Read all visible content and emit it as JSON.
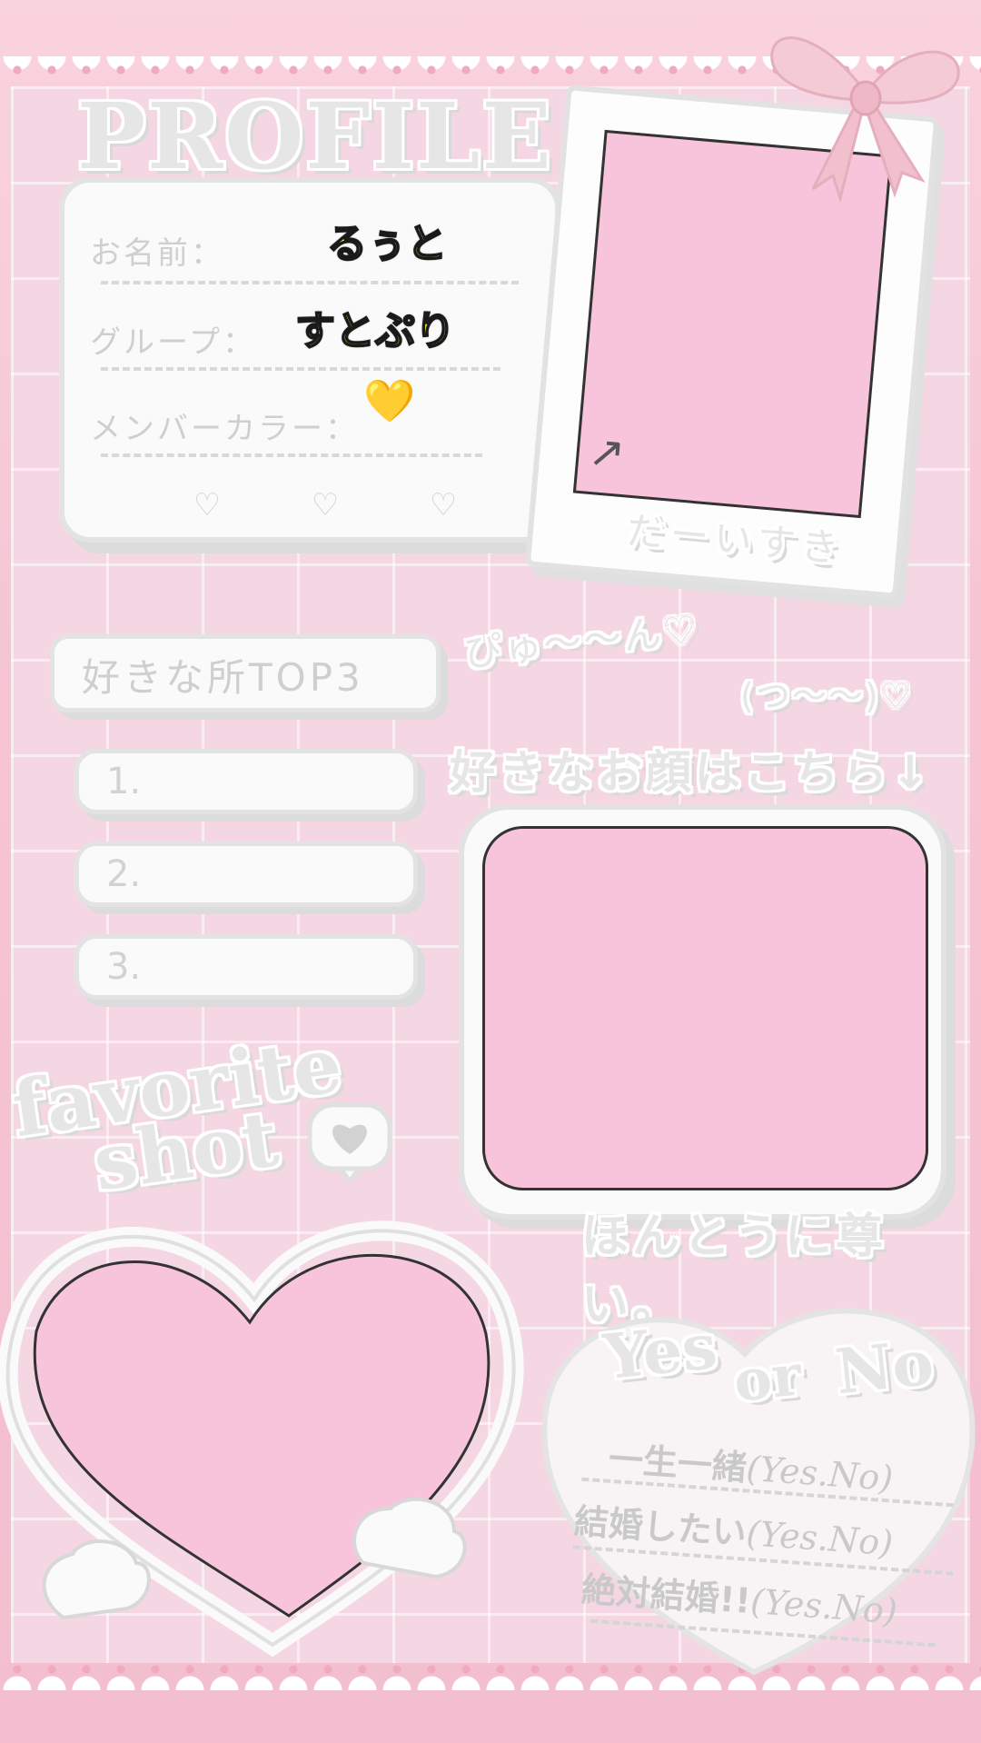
{
  "profile": {
    "title": "PROFILE",
    "name_label": "お名前：",
    "name_value": "るぅと",
    "group_label": "グループ：",
    "group_value": "すとぷり",
    "color_label": "メンバーカラー：",
    "color_value": "💛"
  },
  "polaroid": {
    "caption": "だーいすき"
  },
  "top3": {
    "title": "好きな所TOP3",
    "items": [
      "1.",
      "2.",
      "3."
    ]
  },
  "kaomoji": {
    "line1": "ぴゅ〜〜ん♡",
    "line2": "(つ〜〜)♡"
  },
  "face": {
    "heading": "好きなお顔はこちら↓",
    "caption": "ほんとうに尊い。"
  },
  "favorite": {
    "line1": "favorite",
    "line2": "shot"
  },
  "yesno": {
    "yes": "Yes",
    "or": "or",
    "no": "No",
    "rows": [
      {
        "label": "一生一緒",
        "opts": "(Yes.No)"
      },
      {
        "label": "結婚したい",
        "opts": "(Yes.No)"
      },
      {
        "label": "絶対結婚!!",
        "opts": "(Yes.No)"
      }
    ]
  },
  "colors": {
    "photo_pink": "#f8c4db",
    "background_pink": "#f4d7e3",
    "value_yellow": "#fff33a"
  }
}
